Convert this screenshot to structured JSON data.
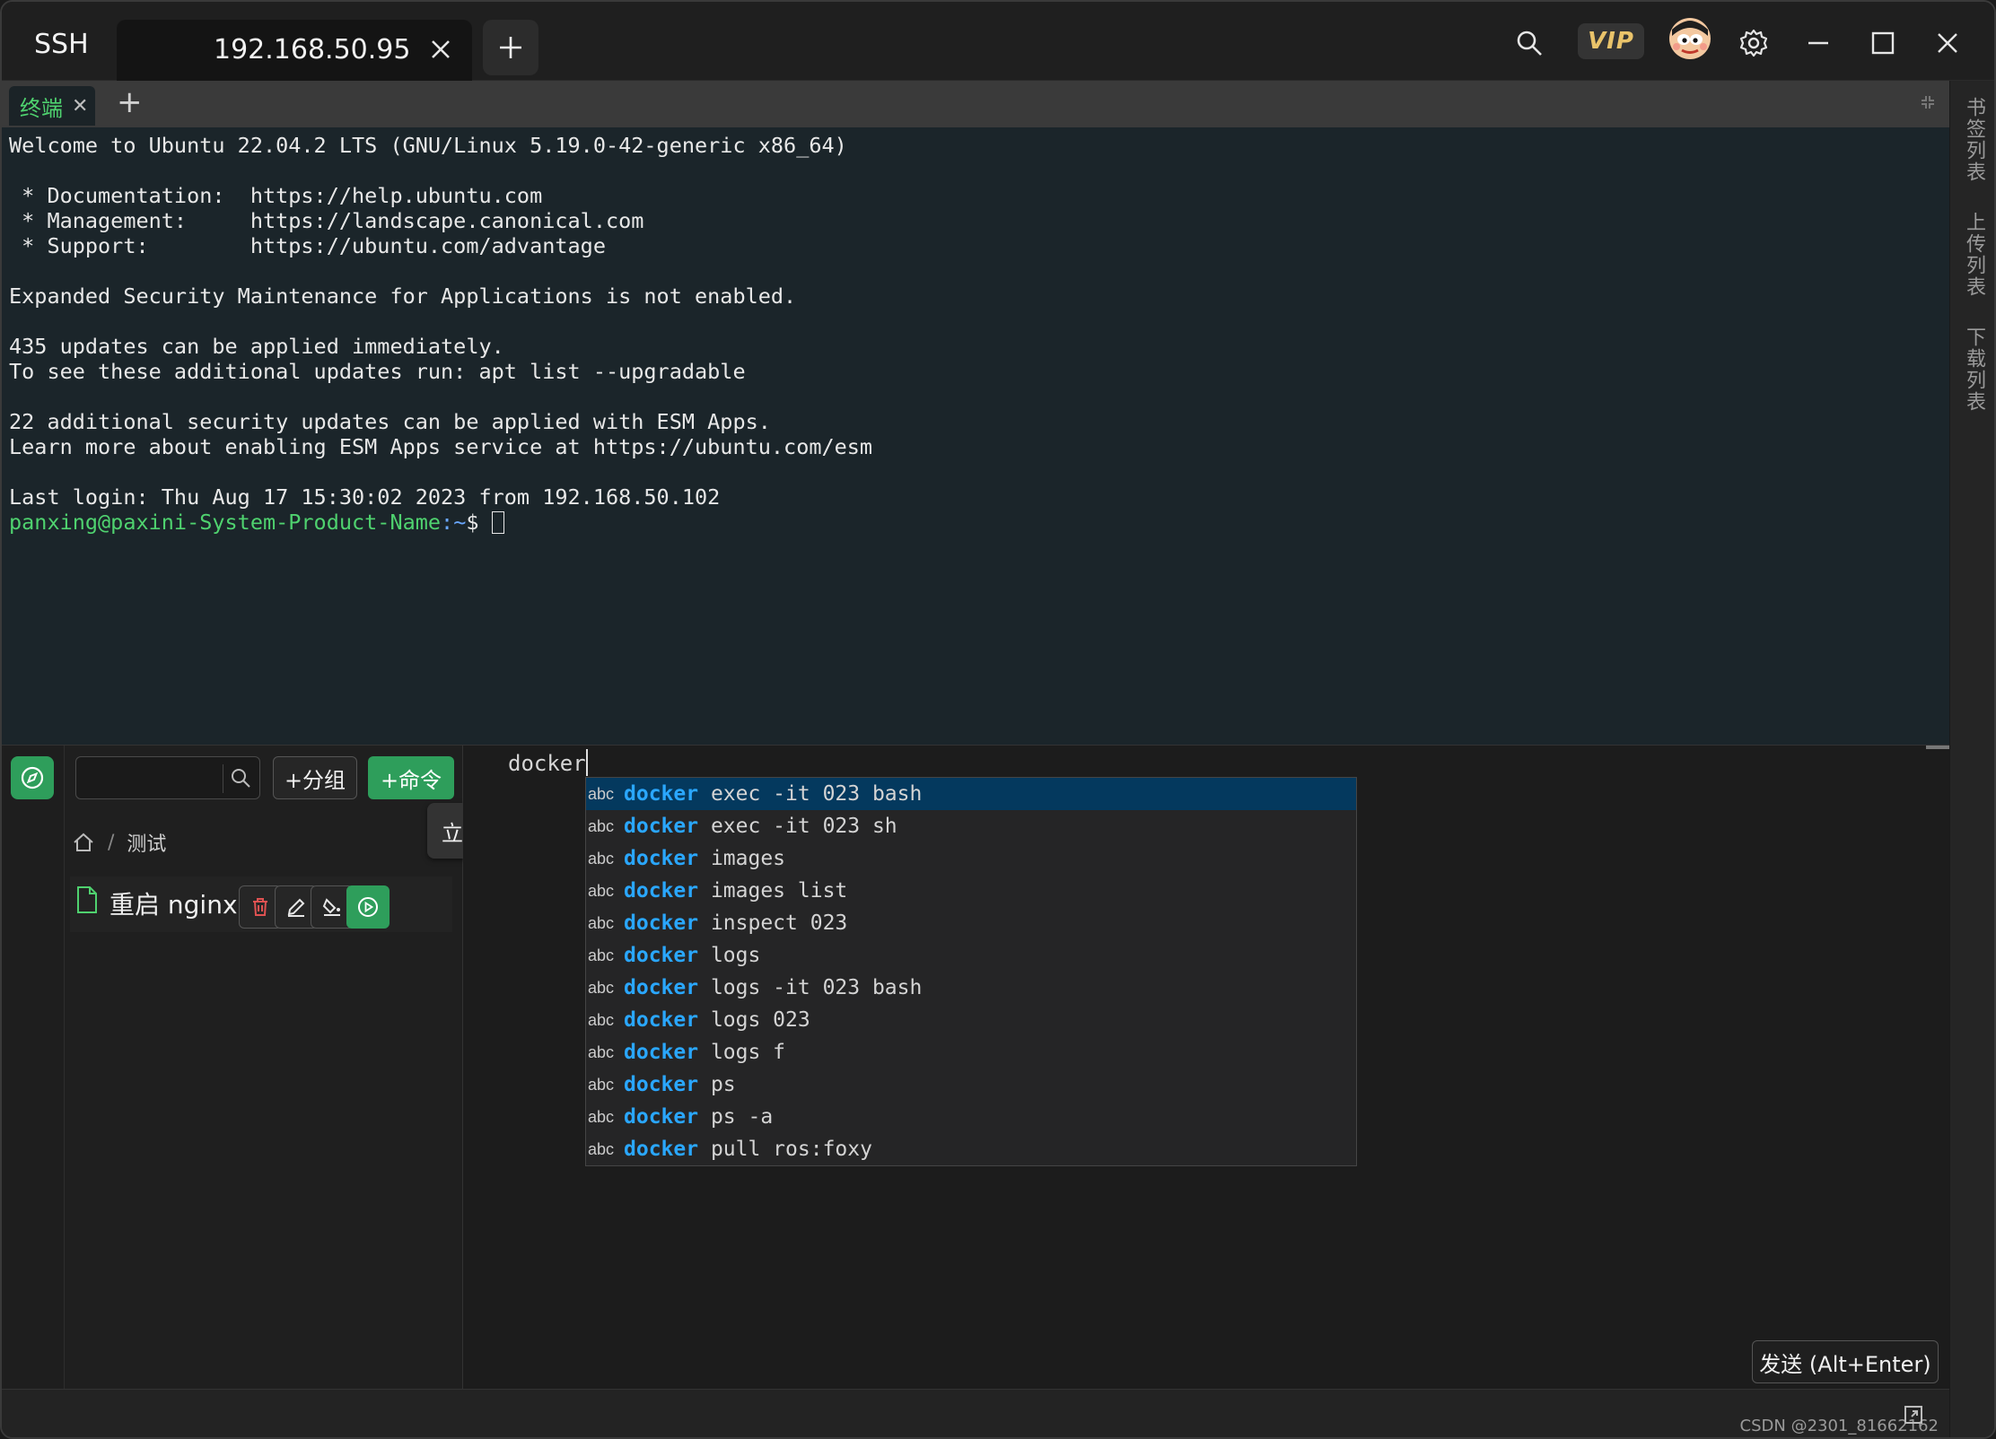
{
  "titlebar": {
    "app_label": "SSH",
    "host_tab": "192.168.50.95",
    "vip_label": "VIP"
  },
  "subtabs": {
    "terminal_tab": "终端",
    "close_glyph": "✕"
  },
  "terminal": {
    "lines": [
      "Welcome to Ubuntu 22.04.2 LTS (GNU/Linux 5.19.0-42-generic x86_64)",
      "",
      " * Documentation:  https://help.ubuntu.com",
      " * Management:     https://landscape.canonical.com",
      " * Support:        https://ubuntu.com/advantage",
      "",
      "Expanded Security Maintenance for Applications is not enabled.",
      "",
      "435 updates can be applied immediately.",
      "To see these additional updates run: apt list --upgradable",
      "",
      "22 additional security updates can be applied with ESM Apps.",
      "Learn more about enabling ESM Apps service at https://ubuntu.com/esm",
      "",
      "Last login: Thu Aug 17 15:30:02 2023 from 192.168.50.102"
    ],
    "prompt_user": "panxing@paxini-System-Product-Name",
    "prompt_path": ":~",
    "prompt_symbol": "$ "
  },
  "right_sidebar": {
    "items": [
      "书签列表",
      "上传列表",
      "下载列表"
    ]
  },
  "command_panel": {
    "search_placeholder": "",
    "group_button": "+分组",
    "command_button": "+命令",
    "breadcrumb_sep": "/",
    "breadcrumb_folder": "测试",
    "tooltip": "立即运行",
    "commands": [
      {
        "name": "重启 nginx"
      }
    ]
  },
  "editor": {
    "input_text": "docker",
    "suggestions": [
      {
        "kind": "abc",
        "keyword": "docker",
        "rest": " exec -it 023 bash",
        "selected": true
      },
      {
        "kind": "abc",
        "keyword": "docker",
        "rest": " exec -it 023 sh"
      },
      {
        "kind": "abc",
        "keyword": "docker",
        "rest": " images"
      },
      {
        "kind": "abc",
        "keyword": "docker",
        "rest": " images list"
      },
      {
        "kind": "abc",
        "keyword": "docker",
        "rest": " inspect 023"
      },
      {
        "kind": "abc",
        "keyword": "docker",
        "rest": " logs"
      },
      {
        "kind": "abc",
        "keyword": "docker",
        "rest": " logs -it 023 bash"
      },
      {
        "kind": "abc",
        "keyword": "docker",
        "rest": " logs 023"
      },
      {
        "kind": "abc",
        "keyword": "docker",
        "rest": " logs f"
      },
      {
        "kind": "abc",
        "keyword": "docker",
        "rest": " ps"
      },
      {
        "kind": "abc",
        "keyword": "docker",
        "rest": " ps -a"
      },
      {
        "kind": "abc",
        "keyword": "docker",
        "rest": " pull ros:foxy"
      }
    ],
    "send_button": "发送 (Alt+Enter)"
  },
  "statusbar": {
    "watermark": "CSDN @2301_81662162"
  },
  "colors": {
    "accent_green": "#2e9e5b",
    "prompt_green": "#4fd26f",
    "keyword_blue": "#2aa7ff",
    "selected_row": "#04395e",
    "vip_gold": "#e9c36a"
  }
}
